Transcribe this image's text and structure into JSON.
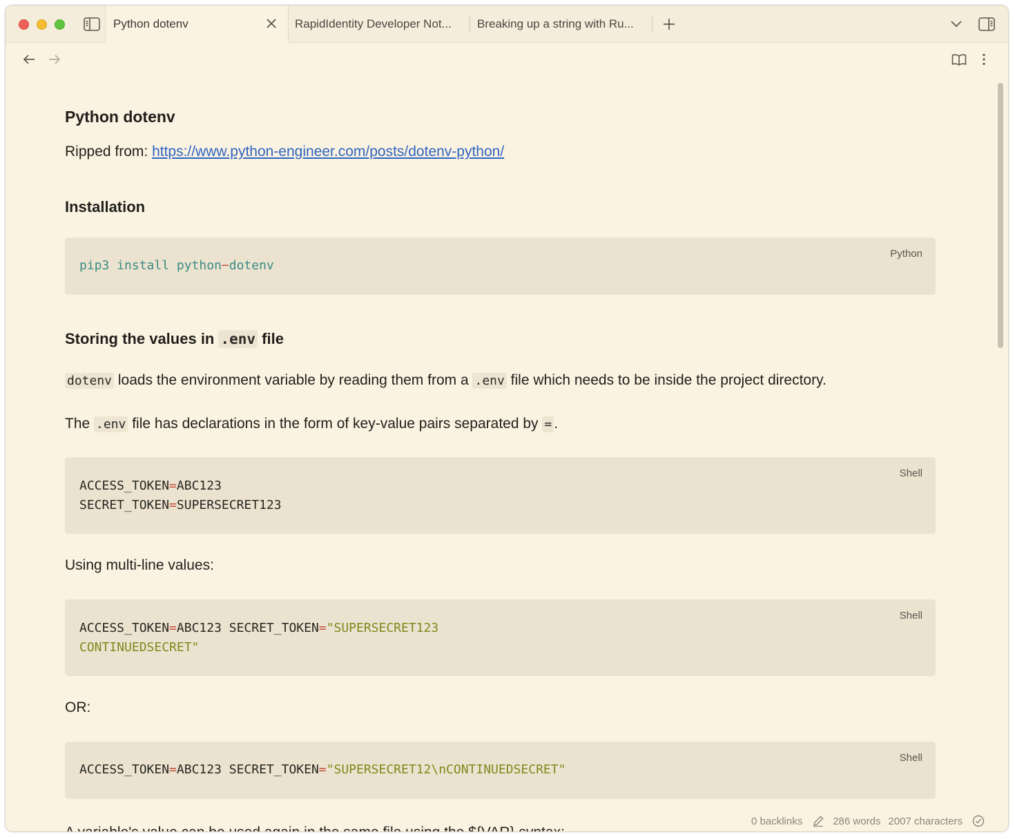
{
  "tabs": {
    "active": {
      "label": "Python dotenv"
    },
    "second": {
      "label": "RapidIdentity Developer Not..."
    },
    "third": {
      "label": "Breaking up a string with Ru..."
    }
  },
  "note": {
    "title": "Python dotenv",
    "ripped_prefix": "Ripped from: ",
    "ripped_link": "https://www.python-engineer.com/posts/dotenv-python/",
    "installation_heading": "Installation",
    "install_block": {
      "lang": "Python",
      "tokens": [
        "pip3 install python",
        "−",
        "dotenv"
      ]
    },
    "storing_heading_pre": "Storing the values in ",
    "storing_heading_code": ".env",
    "storing_heading_post": " file",
    "para1": {
      "code1": "dotenv",
      "text1": " loads the environment variable by reading them from a ",
      "code2": ".env",
      "text2": " file which needs to be inside the project directory."
    },
    "para2": {
      "text1": "The ",
      "code1": ".env",
      "text2": " file has declarations in the form of key-value pairs separated by ",
      "code2": "=",
      "text3": "."
    },
    "shell_block1": {
      "lang": "Shell",
      "line1": {
        "key": "ACCESS_TOKEN",
        "eq": "=",
        "val": "ABC123"
      },
      "line2": {
        "key": "SECRET_TOKEN",
        "eq": "=",
        "val": "SUPERSECRET123"
      }
    },
    "multiline_label": "Using multi-line values:",
    "shell_block2": {
      "lang": "Shell",
      "line1": {
        "key": "ACCESS_TOKEN",
        "eq": "=",
        "val": "ABC123 SECRET_TOKEN",
        "eq2": "=",
        "str": "\"SUPERSECRET123"
      },
      "line2": {
        "str": "CONTINUEDSECRET\""
      }
    },
    "or_label": "OR:",
    "shell_block3": {
      "lang": "Shell",
      "line1": {
        "key": "ACCESS_TOKEN",
        "eq": "=",
        "val": "ABC123 SECRET_TOKEN",
        "eq2": "=",
        "str": "\"SUPERSECRET12\\nCONTINUEDSECRET\""
      }
    },
    "cut_line": "A variable's value can be used again in the same file using the ${VAR} syntax:"
  },
  "status": {
    "backlinks": "0 backlinks",
    "words": "286 words",
    "characters": "2007 characters"
  },
  "icons": {
    "sidebar": "sidebar-toggle-icon",
    "close": "close-icon",
    "new_tab": "plus-icon",
    "tab_list": "chevron-down-icon",
    "right_sidebar": "right-sidebar-toggle-icon",
    "back": "arrow-left-icon",
    "forward": "arrow-right-icon",
    "reading": "book-open-icon",
    "more": "more-vertical-icon",
    "edit": "pencil-icon",
    "sync": "check-circle-icon"
  },
  "colors": {
    "background": "#fbf3e1",
    "code_background": "#ebe3d0",
    "link": "#2f63c2",
    "code_green": "#3b8a82",
    "code_red": "#c44a3a",
    "code_olive": "#7c8a1b"
  }
}
